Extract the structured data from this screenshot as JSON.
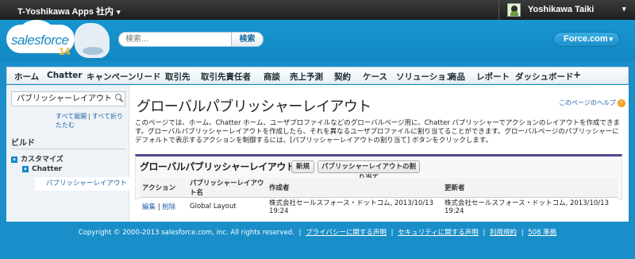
{
  "topbar": {
    "org_name": "T-Yoshikawa Apps 社内",
    "user_name": "Yoshikawa Taiki",
    "caret": "▾"
  },
  "header": {
    "logo_text": "salesforce",
    "logo_version": "14",
    "search_placeholder": "検索...",
    "search_button": "検索",
    "app_picker": "Force.com",
    "app_picker_caret": "▾"
  },
  "tabs": [
    "ホーム",
    "Chatter",
    "キャンペーン",
    "リード",
    "取引先",
    "取引先責任者",
    "商談",
    "売上予測",
    "契約",
    "ケース",
    "ソリューション",
    "商品",
    "レポート",
    "ダッシュボード",
    "+"
  ],
  "sidebar": {
    "quickfind_value": "パブリッシャーレイアウト",
    "expand_all": "すべて展開",
    "collapse_all": "すべて折りたたむ",
    "separator": "|",
    "section_title": "ビルド",
    "tree": [
      {
        "label": "カスタマイズ",
        "toggle": "▾"
      },
      {
        "label": "Chatter",
        "toggle": "▾"
      }
    ],
    "selected_leaf": "パブリッシャーレイアウト"
  },
  "main": {
    "title": "グローバルパブリッシャーレイアウト",
    "help_link": "このページのヘルプ",
    "help_icon": "?",
    "description": "このページでは、ホーム、Chatter ホーム、ユーザプロファイルなどのグローバルページ用に、Chatter パブリッシャーでアクションのレイアウトを作成できます。グローバルパブリッシャーレイアウトを作成したら、それを異なるユーザプロファイルに割り当てることができます。グローバルページのパブリッシャーにデフォルトで表示するアクションを制御するには、[パブリッシャーレイアウトの割り当て] ボタンをクリックします。",
    "related_title": "グローバルパブリッシャーレイアウト",
    "new_button": "新規",
    "assign_button": "パブリッシャーレイアウトの割り当て",
    "table": {
      "headers": [
        "アクション",
        "パブリッシャーレイアウト名",
        "作成者",
        "更新者"
      ],
      "rows": [
        {
          "edit": "編集",
          "sep": "|",
          "del": "削除",
          "name": "Global Layout",
          "created": "株式会社セールスフォース・ドットコム, 2013/10/13 19:24",
          "modified": "株式会社セールスフォース・ドットコム, 2013/10/13 19:24"
        }
      ]
    }
  },
  "footer": {
    "copyright": "Copyright © 2000-2013 salesforce.com, inc. All rights reserved.",
    "links": [
      "プライバシーに関する声明",
      "セキュリティに関する声明",
      "利用規約",
      "508 準拠"
    ],
    "separator": "|"
  }
}
